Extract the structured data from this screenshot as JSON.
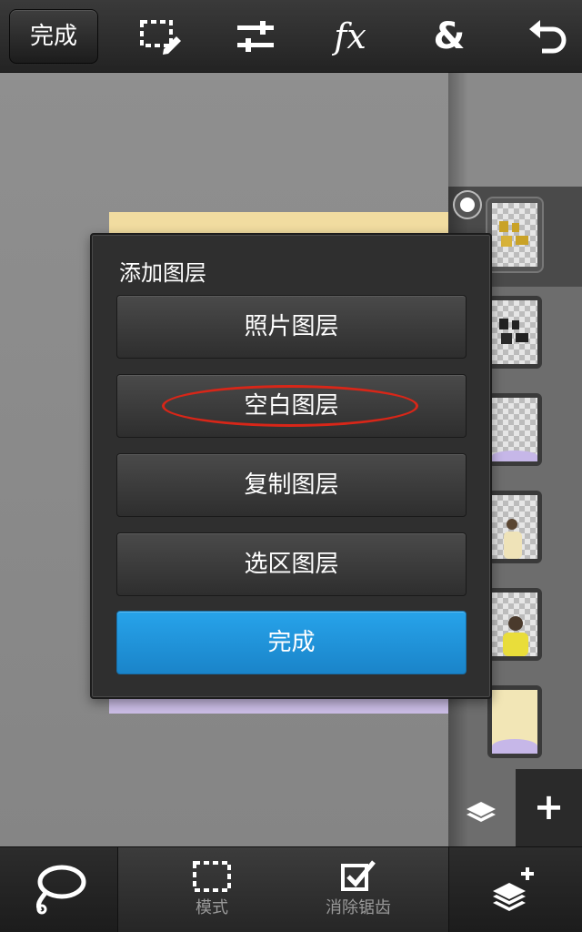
{
  "toolbar": {
    "done_label": "完成",
    "icons": [
      "selection-edit-icon",
      "sliders-icon",
      "fx-icon",
      "blend-icon",
      "undo-icon"
    ],
    "fx_label": "fx",
    "blend_label": "&"
  },
  "dialog": {
    "title": "添加图层",
    "options": [
      "照片图层",
      "空白图层",
      "复制图层",
      "选区图层"
    ],
    "done_label": "完成",
    "highlighted_option": "空白图层"
  },
  "layers_panel": {
    "thumbnail_count": 6,
    "selected_index": 0,
    "add_label": "+"
  },
  "bottom_bar": {
    "mode_label": "模式",
    "antialias_label": "消除锯齿"
  },
  "colors": {
    "accent_blue": "#1f95dc",
    "annotation_red": "#d82618",
    "canvas_yellow": "#f1dca0",
    "canvas_purple": "#cbbde6"
  }
}
